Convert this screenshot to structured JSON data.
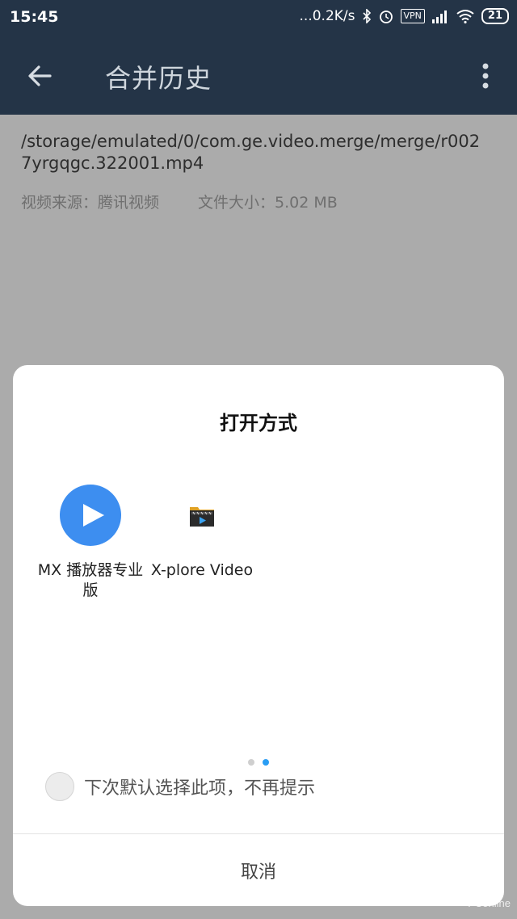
{
  "status_bar": {
    "time": "15:45",
    "net_speed": "...0.2K/s",
    "vpn": "VPN",
    "battery": "21"
  },
  "app_bar": {
    "title": "合并历史",
    "icons": [
      "back-arrow-icon",
      "more-vert-icon"
    ]
  },
  "file": {
    "path": "/storage/emulated/0/com.ge.video.merge/merge/r0027yrgqgc.322001.mp4",
    "source": "视频来源：腾讯视频",
    "size": "文件大小：5.02 MB"
  },
  "dialog": {
    "title": "打开方式",
    "apps": [
      {
        "label": "MX 播放器专业版",
        "icon": "mx-player-icon",
        "color": "#3d8ef0"
      },
      {
        "label": "X-plore Video",
        "icon": "xplore-video-icon"
      }
    ],
    "page_dots": {
      "count": 2,
      "active_index": 1,
      "active_color": "#2a9df4"
    },
    "remember_label": "下次默认选择此项，不再提示",
    "cancel_label": "取消"
  },
  "watermark": "PConline"
}
